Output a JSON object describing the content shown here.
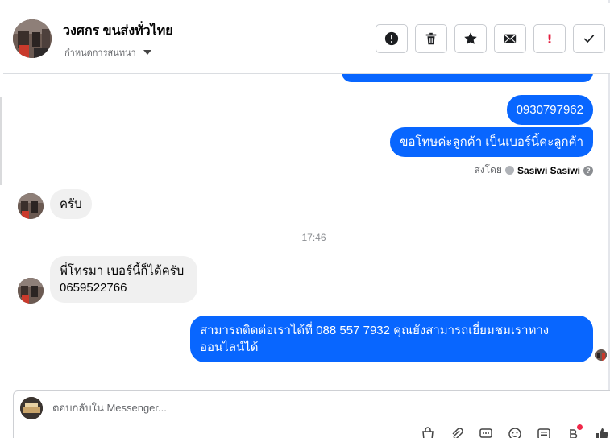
{
  "header": {
    "name": "วงศกร ขนส่งทั่วไทย",
    "subtitle": "กำหนดการสนทนา"
  },
  "actions": {
    "flag_label": "!"
  },
  "messages": {
    "out1": "0930797962",
    "out2": "ขอโทษค่ะลูกค้า เป็นเบอร์นี้ค่ะลูกค้า",
    "sent_by_label": "ส่งโดย",
    "sent_by_name": "Sasiwi Sasiwi",
    "info_icon": "?",
    "in1": "ครับ",
    "time": "17:46",
    "in2": "พี่โทรมา เบอร์นี้ก็ได้ครับ 0659522766",
    "out3": "สามารถติดต่อเราได้ที่ 088 557 7932 คุณยังสามารถเยี่ยมชมเราทางออนไลน์ได้"
  },
  "composer": {
    "placeholder": "ตอบกลับใน Messenger..."
  },
  "colors": {
    "outgoing": "#0866ff",
    "incoming": "#f0f0f0",
    "flag": "#e41e3f"
  }
}
